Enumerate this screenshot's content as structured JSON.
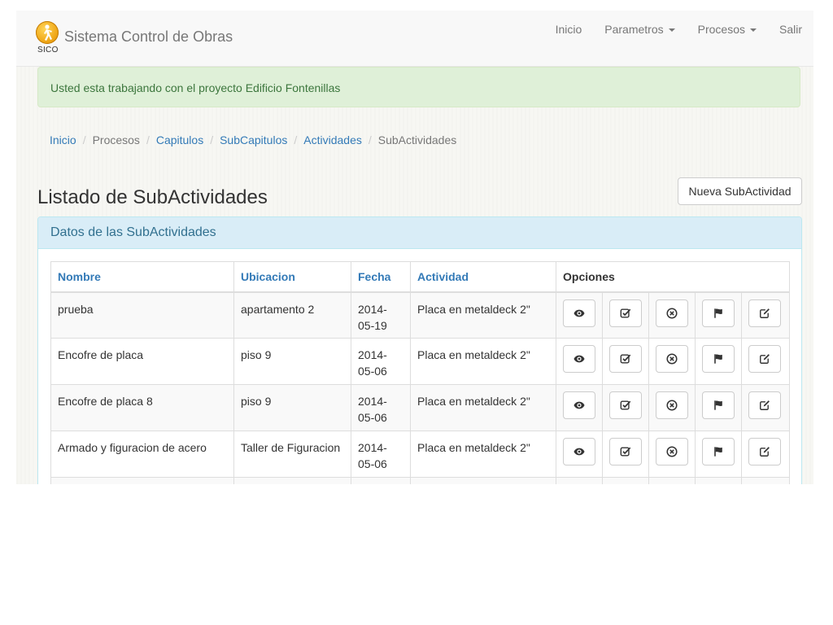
{
  "app": {
    "title": "Sistema Control de Obras",
    "logo_text": "SICO"
  },
  "nav": {
    "inicio": "Inicio",
    "parametros": "Parametros",
    "procesos": "Procesos",
    "salir": "Salir"
  },
  "alert": {
    "text": "Usted esta trabajando con el proyecto Edificio Fontenillas"
  },
  "breadcrumb": [
    {
      "label": "Inicio",
      "link": true
    },
    {
      "label": "Procesos",
      "link": false
    },
    {
      "label": "Capitulos",
      "link": true
    },
    {
      "label": "SubCapitulos",
      "link": true
    },
    {
      "label": "Actividades",
      "link": true
    },
    {
      "label": "SubActividades",
      "link": false
    }
  ],
  "page": {
    "title": "Listado de SubActividades",
    "new_button": "Nueva SubActividad"
  },
  "panel": {
    "heading": "Datos de las SubActividades"
  },
  "table": {
    "headers": {
      "nombre": "Nombre",
      "ubicacion": "Ubicacion",
      "fecha": "Fecha",
      "actividad": "Actividad",
      "opciones": "Opciones"
    },
    "rows": [
      {
        "nombre": "prueba",
        "ubicacion": "apartamento 2",
        "fecha_1": "2014-",
        "fecha_2": "05-19",
        "actividad": "Placa en metaldeck 2\""
      },
      {
        "nombre": "Encofre de placa",
        "ubicacion": "piso 9",
        "fecha_1": "2014-",
        "fecha_2": "05-06",
        "actividad": "Placa en metaldeck 2\""
      },
      {
        "nombre": "Encofre de placa 8",
        "ubicacion": "piso 9",
        "fecha_1": "2014-",
        "fecha_2": "05-06",
        "actividad": "Placa en metaldeck 2\""
      },
      {
        "nombre": "Armado y figuracion de acero",
        "ubicacion": "Taller de Figuracion",
        "fecha_1": "2014-",
        "fecha_2": "05-06",
        "actividad": "Placa en metaldeck 2\""
      },
      {
        "nombre": "",
        "ubicacion": "",
        "fecha_1": "",
        "fecha_2": "",
        "actividad": ""
      }
    ],
    "option_icons": [
      "eye-icon",
      "check-square-icon",
      "x-circle-icon",
      "flag-icon",
      "edit-icon"
    ]
  },
  "colors": {
    "link": "#337ab7",
    "alert_bg": "#dff0d8",
    "alert_text": "#3c763d",
    "panel_heading_bg": "#d9edf7",
    "panel_heading_text": "#31708f",
    "navbar_bg": "#f8f8f8"
  }
}
